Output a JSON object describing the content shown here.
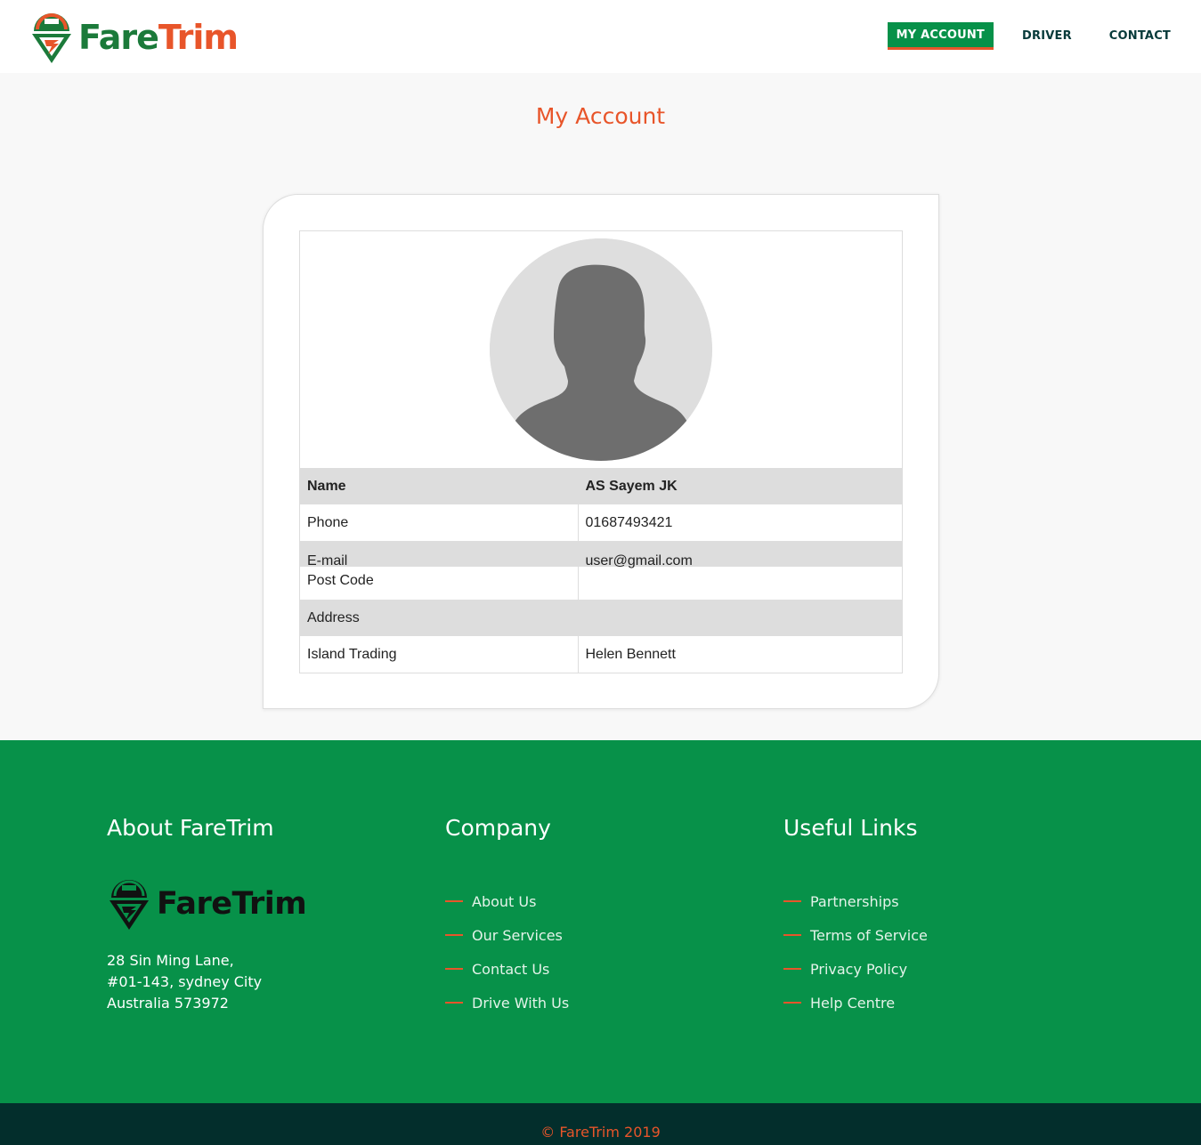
{
  "brand": {
    "name_part1": "Fare",
    "name_part2": "Trim",
    "colors": {
      "green": "#079149",
      "orange": "#e8552a",
      "dark": "#032e2c"
    }
  },
  "nav": {
    "items": [
      {
        "label": "MY ACCOUNT",
        "active": true
      },
      {
        "label": "DRIVER",
        "active": false
      },
      {
        "label": "CONTACT",
        "active": false
      }
    ]
  },
  "page": {
    "title": "My Account"
  },
  "profile": {
    "avatar_icon": "user-silhouette-icon",
    "rows": [
      {
        "label": "Name",
        "value": "AS Sayem JK"
      },
      {
        "label": "Phone",
        "value": "01687493421"
      },
      {
        "label": "E-mail",
        "value": "user@gmail.com"
      },
      {
        "label": "Post Code",
        "value": ""
      },
      {
        "label": "Address",
        "value": ""
      },
      {
        "label": "Island Trading",
        "value": "Helen Bennett"
      }
    ]
  },
  "footer": {
    "about": {
      "heading": "About FareTrim",
      "logo_part1": "Fare",
      "logo_part2": "Trim",
      "address_lines": [
        "28 Sin Ming Lane,",
        "#01-143, sydney City",
        "Australia 573972"
      ]
    },
    "company": {
      "heading": "Company",
      "links": [
        "About Us",
        "Our Services",
        "Contact Us",
        "Drive With Us"
      ]
    },
    "useful": {
      "heading": "Useful Links",
      "links": [
        "Partnerships",
        "Terms of Service",
        "Privacy Policy",
        "Help Centre"
      ]
    },
    "copyright": "© FareTrim 2019"
  }
}
